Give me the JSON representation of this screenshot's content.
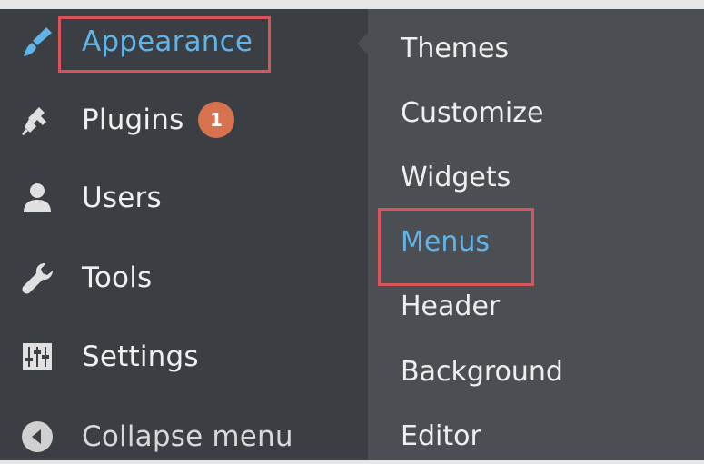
{
  "colors": {
    "sidebar_bg": "#3b3f44",
    "submenu_bg": "#4b4f54",
    "active_text": "#62b4e8",
    "text": "#f0f0f0",
    "badge_bg": "#d7724f",
    "highlight_border": "#d9545a"
  },
  "sidebar": {
    "items": [
      {
        "label": "Appearance",
        "icon": "paintbrush-icon",
        "active": true
      },
      {
        "label": "Plugins",
        "icon": "plug-icon",
        "badge": "1"
      },
      {
        "label": "Users",
        "icon": "user-icon"
      },
      {
        "label": "Tools",
        "icon": "wrench-icon"
      },
      {
        "label": "Settings",
        "icon": "sliders-icon"
      },
      {
        "label": "Collapse menu",
        "icon": "collapse-arrow-icon"
      }
    ]
  },
  "submenu": {
    "items": [
      {
        "label": "Themes"
      },
      {
        "label": "Customize"
      },
      {
        "label": "Widgets"
      },
      {
        "label": "Menus",
        "current": true
      },
      {
        "label": "Header"
      },
      {
        "label": "Background"
      },
      {
        "label": "Editor"
      }
    ]
  }
}
